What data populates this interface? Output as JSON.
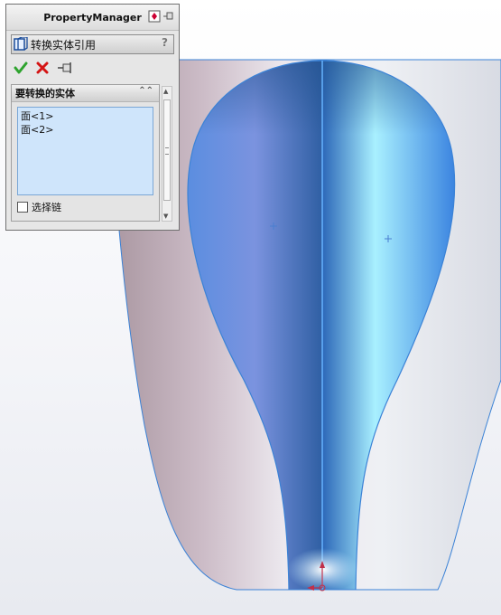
{
  "panel": {
    "title": "PropertyManager",
    "feature_name": "转换实体引用",
    "help_symbol": "?"
  },
  "group": {
    "title": "要转换的实体",
    "items": [
      "面<1>",
      "面<2>"
    ],
    "checkbox_label": "选择链",
    "checkbox_checked": false
  },
  "icons": {
    "title_icons": [
      "collapse-panel-icon",
      "pin-icon"
    ],
    "feature_icon": "convert-entities-icon",
    "actions": [
      "ok-check-icon",
      "cancel-x-icon",
      "pushpin-icon"
    ],
    "group_collapse": "double-chevron-up-icon"
  },
  "colors": {
    "panel_bg": "#e6e6e6",
    "selection_bg": "#cfe5fb",
    "ok_green": "#2ea32e",
    "cancel_red": "#d41414",
    "model_blue": "#5aa0ee",
    "edge_blue": "#3b82d6"
  }
}
